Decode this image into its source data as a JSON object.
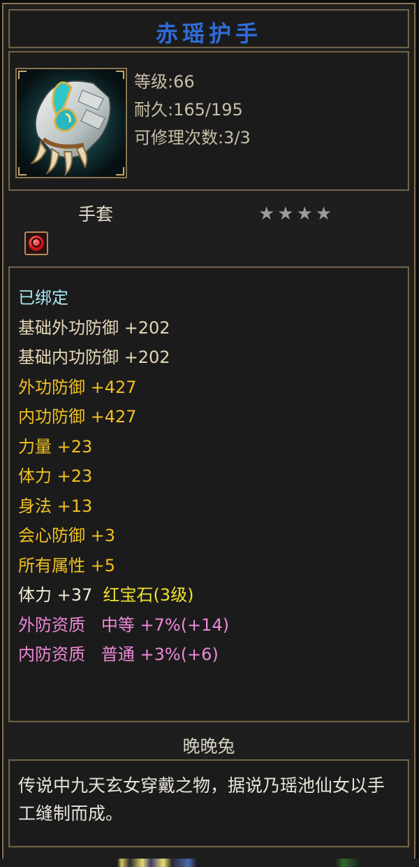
{
  "item": {
    "name": "赤瑶护手",
    "level": "等级:66",
    "durability": "耐久:165/195",
    "repair_count": "可修理次数:3/3",
    "type": "手套",
    "stars": "★★★★",
    "icon": "gauntlet-icon",
    "gem_slot_icon": "red-gem-icon"
  },
  "attributes": [
    {
      "segments": [
        {
          "text": "已绑定",
          "color": "#a8e6f0"
        }
      ]
    },
    {
      "segments": [
        {
          "text": "基础外功防御 +202",
          "color": "#e6d7b8"
        }
      ]
    },
    {
      "segments": [
        {
          "text": "基础内功防御 +202",
          "color": "#e6d7b8"
        }
      ]
    },
    {
      "segments": [
        {
          "text": "外功防御 +427",
          "color": "#f0c020"
        }
      ]
    },
    {
      "segments": [
        {
          "text": "内功防御 +427",
          "color": "#f0c020"
        }
      ]
    },
    {
      "segments": [
        {
          "text": "力量 +23",
          "color": "#f0c020"
        }
      ]
    },
    {
      "segments": [
        {
          "text": "体力 +23",
          "color": "#f0c020"
        }
      ]
    },
    {
      "segments": [
        {
          "text": "身法 +13",
          "color": "#f0c020"
        }
      ]
    },
    {
      "segments": [
        {
          "text": "会心防御 +3",
          "color": "#f0c020"
        }
      ]
    },
    {
      "segments": [
        {
          "text": "所有属性 +5",
          "color": "#f0c020"
        }
      ]
    },
    {
      "segments": [
        {
          "text": "体力 +37  ",
          "color": "#f2ecd8"
        },
        {
          "text": "红宝石(3级)",
          "color": "#f0e22a"
        }
      ]
    },
    {
      "segments": [
        {
          "text": "外防资质   中等 +7%(+14)",
          "color": "#ee88d8"
        }
      ]
    },
    {
      "segments": [
        {
          "text": "内防资质   普通 +3%(+6)",
          "color": "#ee88d8"
        }
      ]
    }
  ],
  "owner": "晚晚兔",
  "description": "传说中九天玄女穿戴之物，据说乃瑶池仙女以手工缝制而成。",
  "colors": {
    "frame": "#8a7551",
    "title": "#2f6bd8",
    "background": "#1e1e1e"
  }
}
